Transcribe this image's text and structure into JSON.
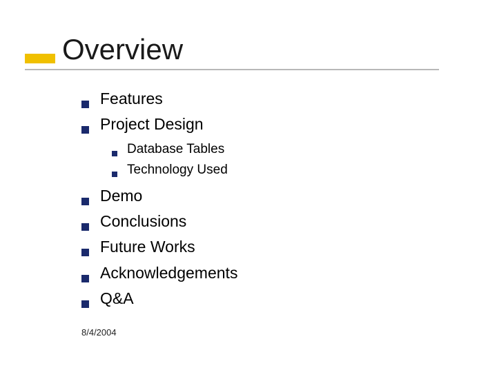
{
  "title": "Overview",
  "bullets_a": {
    "b0": "Features",
    "b1": "Project Design"
  },
  "sub_bullets": {
    "s0": "Database Tables",
    "s1": "Technology Used"
  },
  "bullets_b": {
    "b0": "Demo",
    "b1": "Conclusions",
    "b2": "Future Works",
    "b3": "Acknowledgements",
    "b4": "Q&A"
  },
  "footer": {
    "date": "8/4/2004"
  }
}
